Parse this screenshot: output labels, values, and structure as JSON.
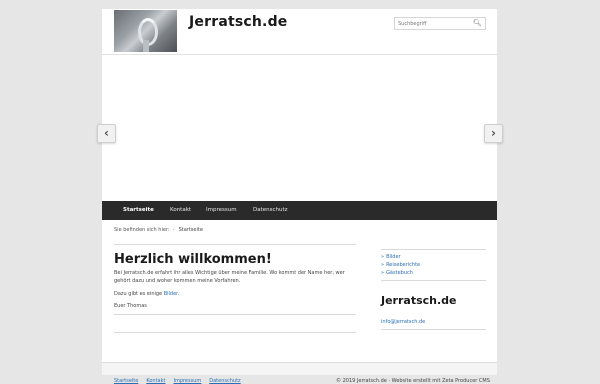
{
  "header": {
    "site_title": "Jerratsch.de",
    "search_placeholder": "Suchbegriff",
    "search_icon": "search-icon"
  },
  "nav": {
    "items": [
      {
        "label": "Startseite",
        "active": true
      },
      {
        "label": "Kontakt",
        "active": false
      },
      {
        "label": "Impressum",
        "active": false
      },
      {
        "label": "Datenschutz",
        "active": false
      }
    ]
  },
  "breadcrumb": {
    "prefix": "Sie befinden sich hier:",
    "current": "Startseite"
  },
  "main": {
    "heading": "Herzlich willkommen!",
    "intro": "Bei Jerratsch.de erfahrt ihr alles Wichtige über meine Familie. Wo kommt der Name her, wer gehört dazu und woher kommen meine Vorfahren.",
    "pictures_prefix": "Dazu gibt es einige ",
    "pictures_link": "Bilder",
    "pictures_suffix": ".",
    "signature": "Euer Thomas"
  },
  "sidebar": {
    "links": [
      "Bilder",
      "Reiseberichte",
      "Gästebuch"
    ],
    "title": "Jerratsch.de",
    "email": "info@jerratsch.de"
  },
  "footer": {
    "links": [
      "Startseite",
      "Kontakt",
      "Impressum",
      "Datenschutz"
    ],
    "copyright": "© 2019 Jerratsch.de · Website erstellt mit Zeta Producer CMS"
  },
  "slider": {
    "prev_icon": "chevron-left-icon",
    "next_icon": "chevron-right-icon"
  },
  "colors": {
    "nav_background": "#2a2a2a",
    "link": "#2a6fb5",
    "page_background": "#e6e6e6"
  }
}
